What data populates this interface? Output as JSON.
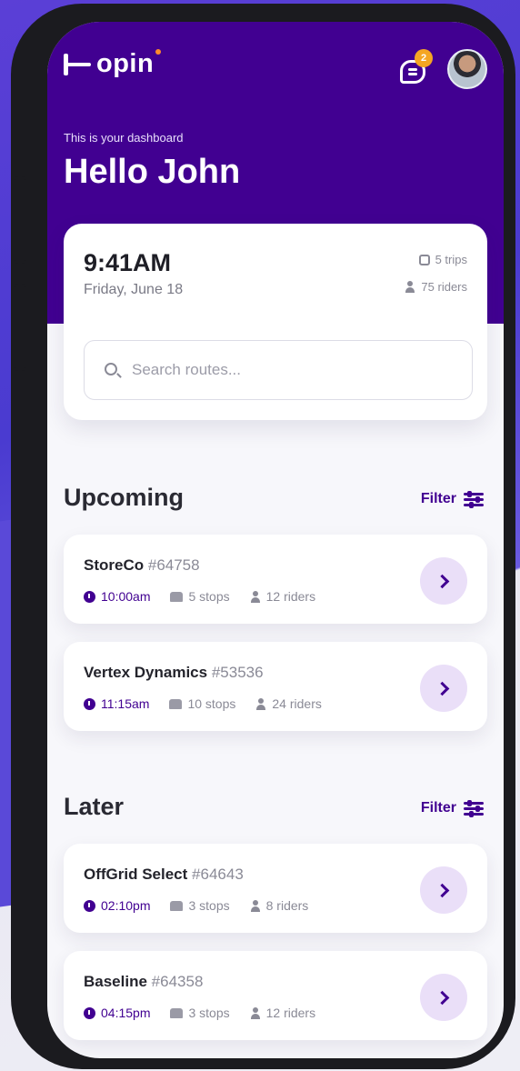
{
  "header": {
    "logo_text": "opin",
    "notification_count": "2",
    "subtitle": "This is your dashboard",
    "greeting": "Hello John"
  },
  "dashboard": {
    "time": "9:41AM",
    "date": "Friday, June 18",
    "trips": "5 trips",
    "riders": "75 riders",
    "search_placeholder": "Search routes..."
  },
  "sections": [
    {
      "title": "Upcoming",
      "filter_label": "Filter",
      "trips": [
        {
          "name": "StoreCo",
          "id": "#64758",
          "time": "10:00am",
          "stops": "5 stops",
          "riders": "12 riders"
        },
        {
          "name": "Vertex Dynamics",
          "id": "#53536",
          "time": "11:15am",
          "stops": "10 stops",
          "riders": "24 riders"
        }
      ]
    },
    {
      "title": "Later",
      "filter_label": "Filter",
      "trips": [
        {
          "name": "OffGrid Select",
          "id": "#64643",
          "time": "02:10pm",
          "stops": "3 stops",
          "riders": "8 riders"
        },
        {
          "name": "Baseline",
          "id": "#64358",
          "time": "04:15pm",
          "stops": "3 stops",
          "riders": "12 riders"
        }
      ]
    }
  ],
  "colors": {
    "primary": "#410091",
    "badge": "#f5a623",
    "accent_dot": "#ff8a2b"
  },
  "icons": [
    "logo-icon",
    "notification-icon",
    "bus-icon",
    "person-icon",
    "search-icon",
    "filter-icon",
    "clock-icon",
    "stops-icon",
    "chevron-right-icon"
  ]
}
